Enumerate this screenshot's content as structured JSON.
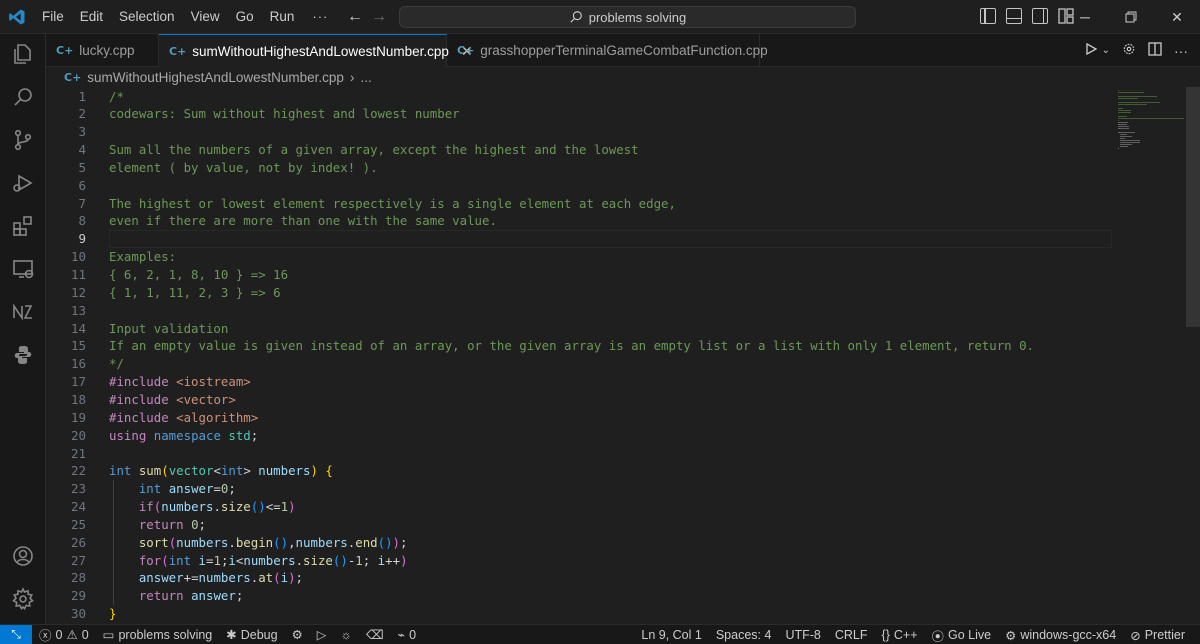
{
  "titlebar": {
    "menu": [
      "File",
      "Edit",
      "Selection",
      "View",
      "Go",
      "Run"
    ],
    "more": "···",
    "search": "problems solving"
  },
  "tabs": [
    {
      "label": "lucky.cpp",
      "active": false
    },
    {
      "label": "sumWithoutHighestAndLowestNumber.cpp",
      "active": true
    },
    {
      "label": "grasshopperTerminalGameCombatFunction.cpp",
      "active": false
    }
  ],
  "breadcrumb": {
    "file": "sumWithoutHighestAndLowestNumber.cpp",
    "tail": "..."
  },
  "editor": {
    "current_line": 9,
    "line_numbers": [
      "1",
      "2",
      "3",
      "4",
      "5",
      "6",
      "7",
      "8",
      "9",
      "10",
      "11",
      "12",
      "13",
      "14",
      "15",
      "16",
      "17",
      "18",
      "19",
      "20",
      "21",
      "22",
      "23",
      "24",
      "25",
      "26",
      "27",
      "28",
      "29",
      "30"
    ],
    "lines": [
      [
        {
          "t": "/*",
          "c": "comment"
        }
      ],
      [
        {
          "t": "codewars: Sum without highest and lowest number",
          "c": "comment"
        }
      ],
      [],
      [
        {
          "t": "Sum all the numbers of a given array, except the highest and the lowest",
          "c": "comment"
        }
      ],
      [
        {
          "t": "element ( by value, not by index! ).",
          "c": "comment"
        }
      ],
      [],
      [
        {
          "t": "The highest or lowest element respectively is a single element at each edge,",
          "c": "comment"
        }
      ],
      [
        {
          "t": "even if there are more than one with the same value.",
          "c": "comment"
        }
      ],
      [],
      [
        {
          "t": "Examples:",
          "c": "comment"
        }
      ],
      [
        {
          "t": "{ 6, 2, 1, 8, 10 } => 16",
          "c": "comment"
        }
      ],
      [
        {
          "t": "{ 1, 1, 11, 2, 3 } => 6",
          "c": "comment"
        }
      ],
      [],
      [
        {
          "t": "Input validation",
          "c": "comment"
        }
      ],
      [
        {
          "t": "If an empty value is given instead of an array, or the given array is an empty list or a list with only 1 element, return 0.",
          "c": "comment"
        }
      ],
      [
        {
          "t": "*/",
          "c": "comment"
        }
      ],
      [
        {
          "t": "#include ",
          "c": "ctrl"
        },
        {
          "t": "<iostream>",
          "c": "str"
        }
      ],
      [
        {
          "t": "#include ",
          "c": "ctrl"
        },
        {
          "t": "<vector>",
          "c": "str"
        }
      ],
      [
        {
          "t": "#include ",
          "c": "ctrl"
        },
        {
          "t": "<algorithm>",
          "c": "str"
        }
      ],
      [
        {
          "t": "using ",
          "c": "ctrl"
        },
        {
          "t": "namespace ",
          "c": "kw"
        },
        {
          "t": "std",
          "c": "type"
        },
        {
          "t": ";",
          "c": "plain"
        }
      ],
      [],
      [
        {
          "t": "int ",
          "c": "kw"
        },
        {
          "t": "sum",
          "c": "fn"
        },
        {
          "t": "(",
          "c": "p1"
        },
        {
          "t": "vector",
          "c": "type"
        },
        {
          "t": "<",
          "c": "plain"
        },
        {
          "t": "int",
          "c": "kw"
        },
        {
          "t": "> ",
          "c": "plain"
        },
        {
          "t": "numbers",
          "c": "var"
        },
        {
          "t": ")",
          "c": "p1"
        },
        {
          "t": " ",
          "c": "plain"
        },
        {
          "t": "{",
          "c": "p1"
        }
      ],
      [
        {
          "t": "    ",
          "c": "plain"
        },
        {
          "t": "int ",
          "c": "kw"
        },
        {
          "t": "answer",
          "c": "var"
        },
        {
          "t": "=",
          "c": "plain"
        },
        {
          "t": "0",
          "c": "num"
        },
        {
          "t": ";",
          "c": "plain"
        }
      ],
      [
        {
          "t": "    ",
          "c": "plain"
        },
        {
          "t": "if",
          "c": "ctrl"
        },
        {
          "t": "(",
          "c": "p2"
        },
        {
          "t": "numbers",
          "c": "var"
        },
        {
          "t": ".",
          "c": "plain"
        },
        {
          "t": "size",
          "c": "fn"
        },
        {
          "t": "()",
          "c": "p3"
        },
        {
          "t": "<=",
          "c": "plain"
        },
        {
          "t": "1",
          "c": "num"
        },
        {
          "t": ")",
          "c": "p2"
        }
      ],
      [
        {
          "t": "    ",
          "c": "plain"
        },
        {
          "t": "return ",
          "c": "ctrl"
        },
        {
          "t": "0",
          "c": "num"
        },
        {
          "t": ";",
          "c": "plain"
        }
      ],
      [
        {
          "t": "    ",
          "c": "plain"
        },
        {
          "t": "sort",
          "c": "fn"
        },
        {
          "t": "(",
          "c": "p2"
        },
        {
          "t": "numbers",
          "c": "var"
        },
        {
          "t": ".",
          "c": "plain"
        },
        {
          "t": "begin",
          "c": "fn"
        },
        {
          "t": "()",
          "c": "p3"
        },
        {
          "t": ",",
          "c": "plain"
        },
        {
          "t": "numbers",
          "c": "var"
        },
        {
          "t": ".",
          "c": "plain"
        },
        {
          "t": "end",
          "c": "fn"
        },
        {
          "t": "()",
          "c": "p3"
        },
        {
          "t": ")",
          "c": "p2"
        },
        {
          "t": ";",
          "c": "plain"
        }
      ],
      [
        {
          "t": "    ",
          "c": "plain"
        },
        {
          "t": "for",
          "c": "ctrl"
        },
        {
          "t": "(",
          "c": "p2"
        },
        {
          "t": "int ",
          "c": "kw"
        },
        {
          "t": "i",
          "c": "var"
        },
        {
          "t": "=",
          "c": "plain"
        },
        {
          "t": "1",
          "c": "num"
        },
        {
          "t": ";",
          "c": "plain"
        },
        {
          "t": "i",
          "c": "var"
        },
        {
          "t": "<",
          "c": "plain"
        },
        {
          "t": "numbers",
          "c": "var"
        },
        {
          "t": ".",
          "c": "plain"
        },
        {
          "t": "size",
          "c": "fn"
        },
        {
          "t": "()",
          "c": "p3"
        },
        {
          "t": "-",
          "c": "plain"
        },
        {
          "t": "1",
          "c": "num"
        },
        {
          "t": "; ",
          "c": "plain"
        },
        {
          "t": "i",
          "c": "var"
        },
        {
          "t": "++",
          "c": "plain"
        },
        {
          "t": ")",
          "c": "p2"
        }
      ],
      [
        {
          "t": "    ",
          "c": "plain"
        },
        {
          "t": "answer",
          "c": "var"
        },
        {
          "t": "+=",
          "c": "plain"
        },
        {
          "t": "numbers",
          "c": "var"
        },
        {
          "t": ".",
          "c": "plain"
        },
        {
          "t": "at",
          "c": "fn"
        },
        {
          "t": "(",
          "c": "p2"
        },
        {
          "t": "i",
          "c": "var"
        },
        {
          "t": ")",
          "c": "p2"
        },
        {
          "t": ";",
          "c": "plain"
        }
      ],
      [
        {
          "t": "    ",
          "c": "plain"
        },
        {
          "t": "return ",
          "c": "ctrl"
        },
        {
          "t": "answer",
          "c": "var"
        },
        {
          "t": ";",
          "c": "plain"
        }
      ],
      [
        {
          "t": "}",
          "c": "p1"
        }
      ]
    ]
  },
  "statusbar": {
    "errors": "0",
    "warnings": "0",
    "folder": "problems solving",
    "debug": "Debug",
    "ports": "0",
    "position": "Ln 9, Col 1",
    "spaces": "Spaces: 4",
    "encoding": "UTF-8",
    "eol": "CRLF",
    "language": "C++",
    "golive": "Go Live",
    "compiler": "windows-gcc-x64",
    "prettier": "Prettier"
  },
  "colors": {
    "accent": "#0078d4",
    "comment": "#6a9955",
    "keyword": "#569cd6"
  }
}
